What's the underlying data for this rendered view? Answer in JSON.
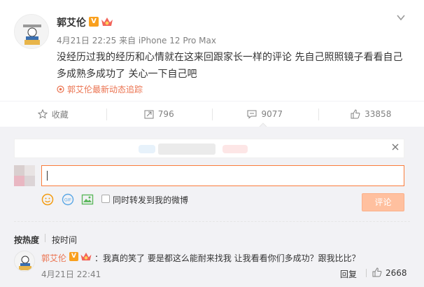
{
  "post": {
    "author": "郭艾伦",
    "verified_badge": "V",
    "meta": "4月21日 22:25 来自 iPhone 12 Pro Max",
    "text": "没经历过我的经历和心情就在这来回跟家长一样的评论 先自己照照镜子看看自己多成熟多成功了 关心一下自己吧",
    "tracking": "郭艾伦最新动态追踪"
  },
  "actions": {
    "favorite": "收藏",
    "repost": "796",
    "comment": "9077",
    "like": "33858"
  },
  "composer": {
    "input_value": "",
    "repost_label": "同时转发到我的微博",
    "submit": "评论"
  },
  "sort": {
    "hot": "按热度",
    "time": "按时间"
  },
  "comment": {
    "author": "郭艾伦",
    "verified_badge": "V",
    "text": "：我真的笑了 要是都这么能耐来找我 让我看看你们多成功？跟我比比？",
    "time": "4月21日 22:41",
    "reply": "回复",
    "likes": "2668"
  },
  "colors": {
    "accent": "#eb7350",
    "input_border": "#fa7d3c",
    "submit_bg": "#ffc09f",
    "badge": "#f9a01e"
  }
}
